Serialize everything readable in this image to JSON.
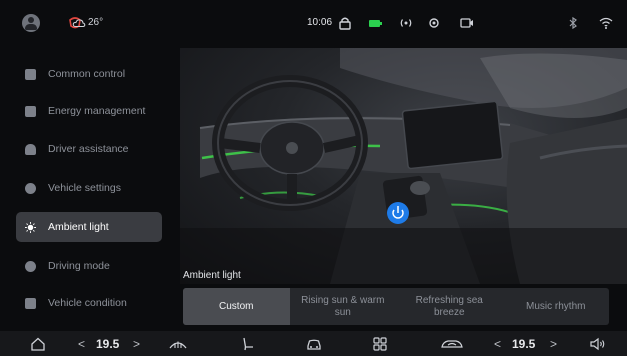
{
  "status_bar": {
    "outside_temp": "26°",
    "clock": "10:06"
  },
  "nav": {
    "items": [
      {
        "label": "Common control",
        "icon": "grid-icon"
      },
      {
        "label": "Energy management",
        "icon": "battery-icon"
      },
      {
        "label": "Driver assistance",
        "icon": "car-front-icon"
      },
      {
        "label": "Vehicle settings",
        "icon": "gear-icon"
      },
      {
        "label": "Ambient light",
        "icon": "sun-icon",
        "active": true
      },
      {
        "label": "Driving mode",
        "icon": "gauge-icon"
      },
      {
        "label": "Vehicle condition",
        "icon": "chart-icon"
      }
    ]
  },
  "ambient": {
    "caption": "Ambient light",
    "power_on": true,
    "accent_color": "#3fcf4a",
    "power_button_color": "#1e7be8",
    "options": [
      {
        "label": "Custom",
        "selected": true
      },
      {
        "label": "Rising sun & warm sun"
      },
      {
        "label": "Refreshing sea breeze"
      },
      {
        "label": "Music rhythm"
      }
    ]
  },
  "dock": {
    "driver_temp": "19.5",
    "passenger_temp": "19.5",
    "left_arrow": "<",
    "right_arrow": ">"
  }
}
